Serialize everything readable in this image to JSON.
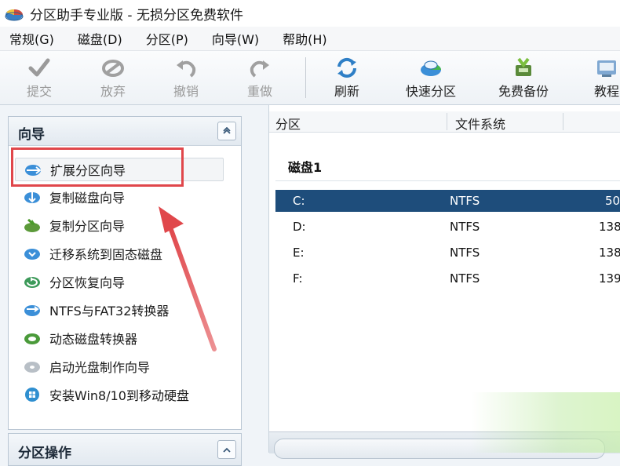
{
  "window": {
    "title": "分区助手专业版 - 无损分区免费软件"
  },
  "menu": [
    "常规(G)",
    "磁盘(D)",
    "分区(P)",
    "向导(W)",
    "帮助(H)"
  ],
  "toolbar": {
    "commit": "提交",
    "discard": "放弃",
    "undo": "撤销",
    "redo": "重做",
    "refresh": "刷新",
    "quick_partition": "快速分区",
    "free_backup": "免费备份",
    "tutorial": "教程"
  },
  "wizard_panel": {
    "title": "向导",
    "items": [
      "扩展分区向导",
      "复制磁盘向导",
      "复制分区向导",
      "迁移系统到固态磁盘",
      "分区恢复向导",
      "NTFS与FAT32转换器",
      "动态磁盘转换器",
      "启动光盘制作向导",
      "安装Win8/10到移动硬盘"
    ]
  },
  "ops_panel": {
    "title": "分区操作"
  },
  "partition_table": {
    "headers": [
      "分区",
      "文件系统"
    ],
    "disk_label": "磁盘1",
    "rows": [
      {
        "partition": "C:",
        "fs": "NTFS",
        "capacity": "50"
      },
      {
        "partition": "D:",
        "fs": "NTFS",
        "capacity": "138"
      },
      {
        "partition": "E:",
        "fs": "NTFS",
        "capacity": "138"
      },
      {
        "partition": "F:",
        "fs": "NTFS",
        "capacity": "139"
      }
    ]
  },
  "colors": {
    "highlight": "#e0474b",
    "arrow": "#e0474b",
    "selected_row": "#1e4d7b"
  }
}
